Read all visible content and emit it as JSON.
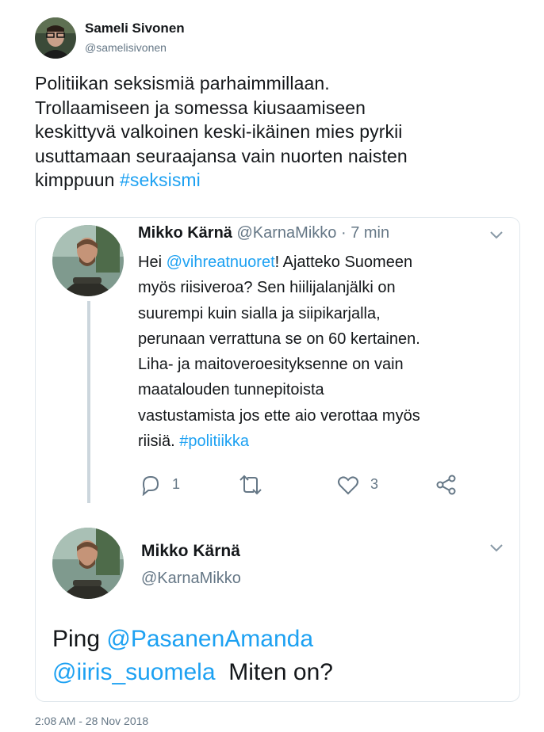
{
  "tweet": {
    "author_name": "Sameli Sivonen",
    "author_handle": "@samelisivonen",
    "text_lines": [
      "Politiikan seksismiä parhaimmillaan.",
      "Trollaamiseen ja somessa kiusaamiseen",
      "keskittyvä valkoinen keski-ikäinen mies pyrkii",
      "usuttamaan seuraajansa vain nuorten naisten"
    ],
    "last_line_text": "kimppuun ",
    "hashtag": "#seksismi",
    "timestamp": "2:08 AM - 28 Nov 2018"
  },
  "quoted": {
    "name": "Mikko Kärnä",
    "handle": "@KarnaMikko",
    "separator": " · ",
    "time": "7 min",
    "line1_prefix": "Hei ",
    "mention": "@vihreatnuoret",
    "line1_suffix": "! Ajatteko Suomeen",
    "lines": [
      "myös riisiveroa? Sen hiilijalanjälki on",
      "suurempi kuin sialla ja siipikarjalla,",
      "perunaan verrattuna se on 60 kertainen.",
      "Liha- ja maitoveroesityksenne on vain",
      "maatalouden tunnepitoista",
      "vastustamista jos ette aio verottaa myös"
    ],
    "last_prefix": "riisiä. ",
    "hashtag": "#politiikka",
    "reply_count": "1",
    "like_count": "3",
    "icons": [
      "reply-icon",
      "retweet-icon",
      "like-icon",
      "share-icon",
      "chevron-down-icon"
    ]
  },
  "reply2": {
    "name": "Mikko Kärnä",
    "handle": "@KarnaMikko",
    "ping": "Ping ",
    "mention1": "@PasanenAmanda",
    "mention2": "@iiris_suomela",
    "suffix": "  Miten on?"
  },
  "colors": {
    "link": "#1da1f2",
    "muted": "#657786",
    "border": "#e1e8ed",
    "thread": "#ccd6dd"
  }
}
